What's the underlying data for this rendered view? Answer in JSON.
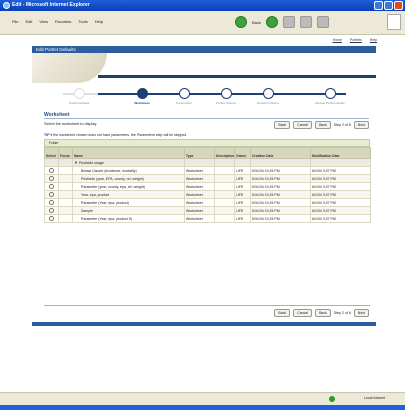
{
  "window": {
    "title": "Edit - Microsoft Internet Explorer"
  },
  "menus": [
    "File",
    "Edit",
    "View",
    "Favorites",
    "Tools",
    "Help"
  ],
  "toolbar": {
    "back_label": "Back"
  },
  "toplinks": [
    "Home",
    "Portlets",
    "Help"
  ],
  "banner": {
    "title": "Edit Portlet Defaults"
  },
  "train": {
    "steps": [
      "Portlet Defaults",
      "Worksheet",
      "Parameters",
      "Portlet Options",
      "Refresh Options",
      "Review Portlet Details"
    ],
    "current": 1
  },
  "section": {
    "title": "Worksheet",
    "instruction": "Select the worksheet to display."
  },
  "buttons": {
    "back": "Back",
    "cancel": "Cancel",
    "prev": "Back",
    "step": "Step 2 of 6",
    "next": "Next"
  },
  "tip": {
    "label": "TIP",
    "text": "If the worksheet chosen does not have parameters, the Parameters step will be skipped."
  },
  "grid_toolbar": {
    "label": "Folder"
  },
  "table": {
    "columns": [
      "Select",
      "Focus",
      "Name",
      "Type",
      "Description",
      "Owner",
      "Creation Date",
      "Modification Date"
    ],
    "parent": {
      "name": "Pesticide usage"
    },
    "rows": [
      {
        "name": "Breast Cancer (incidence, mortality)",
        "type": "Worksheet",
        "owner": "LIFE",
        "created": "5/31/04 10:25 PM",
        "modified": "6/2/04 3:37 PM"
      },
      {
        "name": "Pesticide (year, EPA, county, rel, weight)",
        "type": "Worksheet",
        "owner": "LIFE",
        "created": "5/31/04 10:25 PM",
        "modified": "6/2/04 3:37 PM"
      },
      {
        "name": "Parameter (year, county, epa, rel, weight)",
        "type": "Worksheet",
        "owner": "LIFE",
        "created": "5/31/04 10:25 PM",
        "modified": "6/2/04 3:37 PM"
      },
      {
        "name": "Year, epa, product",
        "type": "Worksheet",
        "owner": "LIFE",
        "created": "5/31/04 10:25 PM",
        "modified": "6/2/04 3:37 PM"
      },
      {
        "name": "Parameter (Year, epa, product)",
        "type": "Worksheet",
        "owner": "LIFE",
        "created": "5/31/04 10:25 PM",
        "modified": "6/2/04 3:37 PM"
      },
      {
        "name": "Sample",
        "type": "Worksheet",
        "owner": "LIFE",
        "created": "5/31/04 10:25 PM",
        "modified": "6/2/04 3:37 PM"
      },
      {
        "name": "Parameter (Year, epa, product 5)",
        "type": "Worksheet",
        "owner": "LIFE",
        "created": "5/31/04 10:25 PM",
        "modified": "6/2/04 3:37 PM"
      }
    ]
  },
  "statusbar": {
    "zone": "Local intranet"
  }
}
